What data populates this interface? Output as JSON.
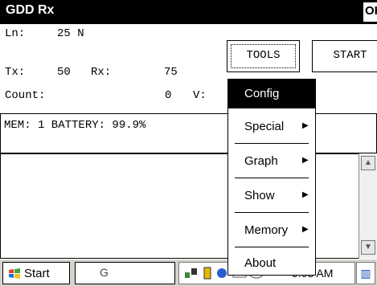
{
  "window": {
    "title": "GDD Rx",
    "ok_label": "OK"
  },
  "readings": {
    "ln_label": "Ln:",
    "ln_value": "25 N",
    "tx_label": "Tx:",
    "tx_value": "50",
    "rx_label": "Rx:",
    "rx_value": "75",
    "count_label": "Count:",
    "count_value": "0",
    "v_label": "V:"
  },
  "buttons": {
    "tools": "TOOLS",
    "start": "START"
  },
  "status": {
    "text": "MEM: 1 BATTERY: 99.9%"
  },
  "menu": {
    "items": [
      {
        "label": "Config",
        "submenu": false,
        "selected": true
      },
      {
        "label": "Special",
        "submenu": true
      },
      {
        "label": "Graph",
        "submenu": true
      },
      {
        "label": "Show",
        "submenu": true
      },
      {
        "label": "Memory",
        "submenu": true
      },
      {
        "label": "About",
        "submenu": false
      }
    ]
  },
  "taskbar": {
    "start_label": "Start",
    "task_partial": "G",
    "time": "9:03 AM"
  },
  "colors": {
    "titlebar": "#000000",
    "selected": "#000000",
    "taskbar": "#d6d3ce"
  },
  "icons": [
    "windows-flag-icon",
    "scroll-up-icon",
    "scroll-down-icon",
    "network-icon",
    "battery-icon",
    "sound-icon",
    "keyboard-icon",
    "submenu-arrow-icon"
  ]
}
